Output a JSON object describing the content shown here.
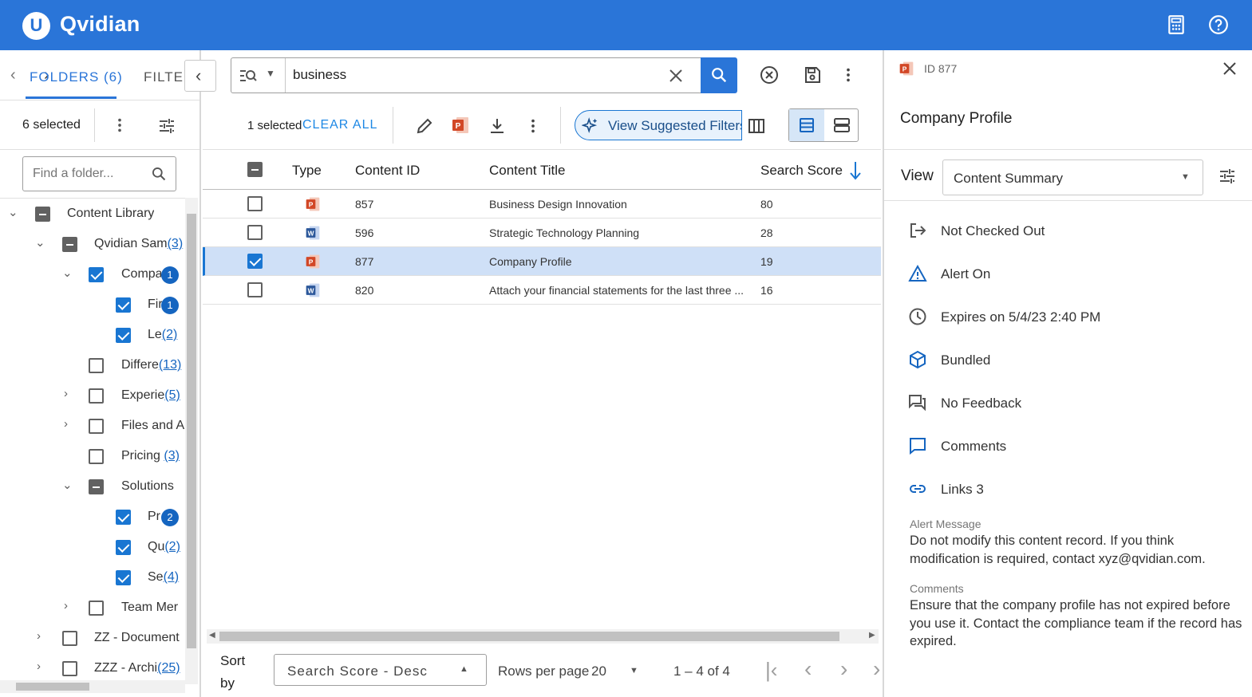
{
  "app": {
    "name": "Qvidian",
    "logo_letter": "U",
    "accent": "#2a75d8"
  },
  "left": {
    "tab_folders": "FOLDERS (6)",
    "tab_filters": "FILTERS",
    "selected": "6 selected",
    "find_placeholder": "Find a folder...",
    "tree": [
      {
        "label": "Content Library",
        "count": "",
        "badge": ""
      },
      {
        "label": "Qvidian Sam",
        "count": "(3)",
        "badge": ""
      },
      {
        "label": "Compa",
        "count": "",
        "badge": "1"
      },
      {
        "label": "Fir",
        "count": "",
        "badge": "1"
      },
      {
        "label": "Le",
        "count": "(2)",
        "badge": ""
      },
      {
        "label": "Differe",
        "count": "(13)",
        "badge": ""
      },
      {
        "label": "Experie",
        "count": "(5)",
        "badge": ""
      },
      {
        "label": "Files and A",
        "count": "",
        "badge": ""
      },
      {
        "label": "Pricing",
        "count": "(3)",
        "badge": ""
      },
      {
        "label": "Solutions",
        "count": "",
        "badge": ""
      },
      {
        "label": "Pr",
        "count": "",
        "badge": "2"
      },
      {
        "label": "Qu",
        "count": "(2)",
        "badge": ""
      },
      {
        "label": "Se",
        "count": "(4)",
        "badge": ""
      },
      {
        "label": "Team Mer",
        "count": "",
        "badge": ""
      },
      {
        "label": "ZZ - Document",
        "count": "",
        "badge": ""
      },
      {
        "label": "ZZZ - Archi",
        "count": "(25)",
        "badge": ""
      }
    ]
  },
  "search": {
    "value": "business"
  },
  "toolbar": {
    "selected": "1 selected",
    "clear_all": "CLEAR ALL",
    "suggested": "View Suggested Filters"
  },
  "table": {
    "headers": {
      "type": "Type",
      "id": "Content ID",
      "title": "Content Title",
      "score": "Search Score"
    },
    "rows": [
      {
        "type": "powerpoint",
        "id": "857",
        "title": "Business Design Innovation",
        "score": "80"
      },
      {
        "type": "word",
        "id": "596",
        "title": "Strategic Technology Planning",
        "score": "28"
      },
      {
        "type": "powerpoint",
        "id": "877",
        "title": "Company Profile",
        "score": "19"
      },
      {
        "type": "word",
        "id": "820",
        "title": "Attach your financial statements for the last three ...",
        "score": "16"
      }
    ]
  },
  "footer": {
    "sort_by": "Sort by",
    "sort_value": "Search Score - Desc",
    "rows_per_page": "Rows per page",
    "rows_value": "20",
    "range": "1 – 4 of 4"
  },
  "detail": {
    "id": "ID 877",
    "title": "Company Profile",
    "view_label": "View",
    "view_value": "Content Summary",
    "props": [
      {
        "icon": "check-out-icon",
        "text": "Not Checked Out"
      },
      {
        "icon": "warning-icon",
        "text": "Alert On"
      },
      {
        "icon": "clock-icon",
        "text": "Expires on 5/4/23 2:40 PM"
      },
      {
        "icon": "bundle-icon",
        "text": "Bundled"
      },
      {
        "icon": "feedback-icon",
        "text": "No Feedback"
      },
      {
        "icon": "comment-icon",
        "text": "Comments"
      },
      {
        "icon": "link-icon",
        "text": "Links 3"
      }
    ],
    "alert_label": "Alert Message",
    "alert_text": "Do not modify this content record. If you think modification is required, contact xyz@qvidian.com.",
    "comments_label": "Comments",
    "comments_text": "Ensure that the company profile has not expired before you use it. Contact the compliance team if the record has expired."
  }
}
